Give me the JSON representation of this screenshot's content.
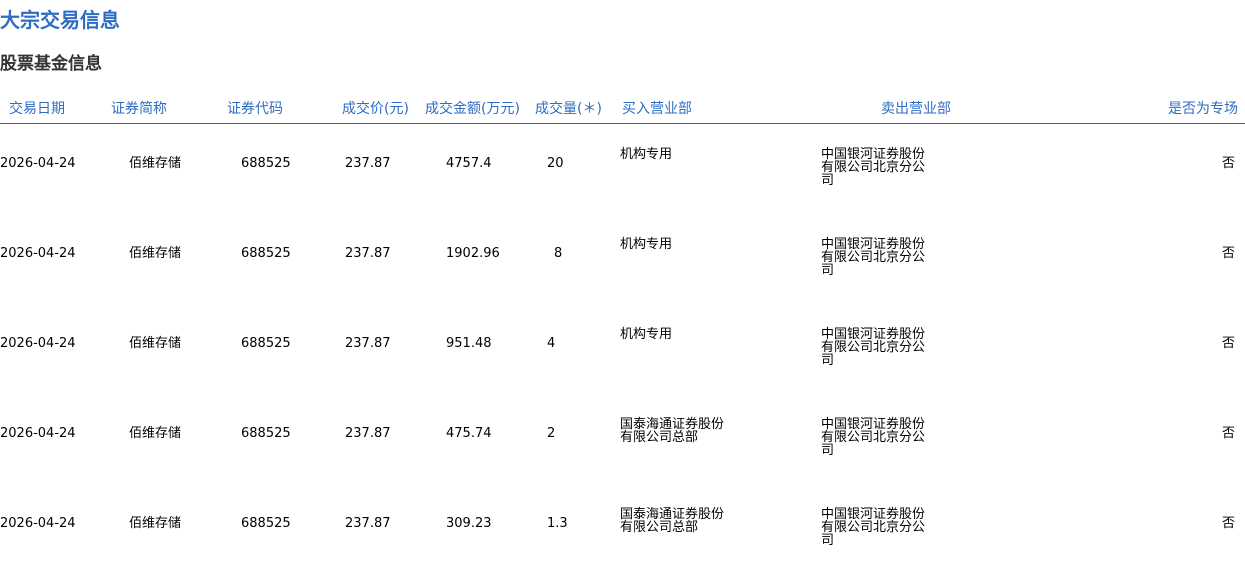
{
  "page_title": "大宗交易信息",
  "section_title": "股票基金信息",
  "columns": {
    "date": "交易日期",
    "name": "证券简称",
    "code": "证券代码",
    "price": "成交价(元)",
    "amount": "成交金额(万元)",
    "volume": "成交量(＊)",
    "buyer": "买入营业部",
    "seller": "卖出营业部",
    "special": "是否为专场"
  },
  "rows": [
    {
      "date": "2026-04-24",
      "name": "佰维存储",
      "code": "688525",
      "price": "237.87",
      "amount": "4757.4",
      "volume": "20",
      "buyer": "机构专用",
      "seller": "中国银河证券股份有限公司北京分公司",
      "special": "否"
    },
    {
      "date": "2026-04-24",
      "name": "佰维存储",
      "code": "688525",
      "price": "237.87",
      "amount": "1902.96",
      "volume": "8",
      "buyer": "机构专用",
      "seller": "中国银河证券股份有限公司北京分公司",
      "special": "否"
    },
    {
      "date": "2026-04-24",
      "name": "佰维存储",
      "code": "688525",
      "price": "237.87",
      "amount": "951.48",
      "volume": "4",
      "buyer": "机构专用",
      "seller": "中国银河证券股份有限公司北京分公司",
      "special": "否"
    },
    {
      "date": "2026-04-24",
      "name": "佰维存储",
      "code": "688525",
      "price": "237.87",
      "amount": "475.74",
      "volume": "2",
      "buyer": "国泰海通证券股份有限公司总部",
      "seller": "中国银河证券股份有限公司北京分公司",
      "special": "否"
    },
    {
      "date": "2026-04-24",
      "name": "佰维存储",
      "code": "688525",
      "price": "237.87",
      "amount": "309.23",
      "volume": "1.3",
      "buyer": "国泰海通证券股份有限公司总部",
      "seller": "中国银河证券股份有限公司北京分公司",
      "special": "否"
    }
  ],
  "colors": {
    "title": "#2d6ec4",
    "header_text": "#2d6ec4",
    "header_rule": "#2e7d32"
  }
}
